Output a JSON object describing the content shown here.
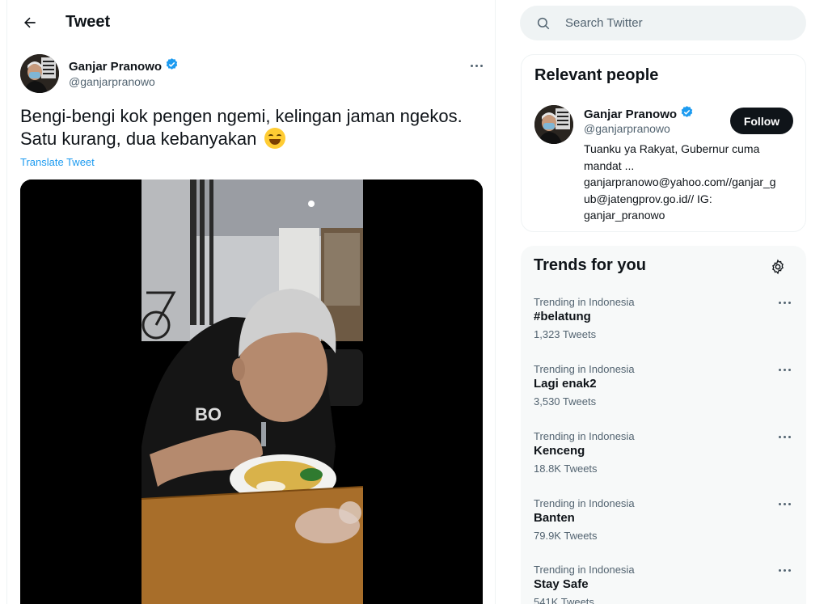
{
  "header": {
    "title": "Tweet"
  },
  "tweet": {
    "author_name": "Ganjar Pranowo",
    "author_handle": "@ganjarpranowo",
    "text_line1": "Bengi-bengi kok pengen ngemi, kelingan jaman ngekos.",
    "text_line2": "Satu kurang, dua kebanyakan",
    "translate_label": "Translate Tweet"
  },
  "search": {
    "placeholder": "Search Twitter"
  },
  "relevant_people": {
    "title": "Relevant people",
    "name": "Ganjar Pranowo",
    "handle": "@ganjarpranowo",
    "follow_label": "Follow",
    "bio_lines": [
      "Tuanku ya Rakyat, Gubernur cuma",
      "mandat ...",
      "ganjarpranowo@yahoo.com//ganjar_g",
      "ub@jatengprov.go.id// IG:",
      "ganjar_pranowo"
    ]
  },
  "trends": {
    "title": "Trends for you",
    "items": [
      {
        "context": "Trending in Indonesia",
        "name": "#belatung",
        "count": "1,323 Tweets"
      },
      {
        "context": "Trending in Indonesia",
        "name": "Lagi enak2",
        "count": "3,530 Tweets"
      },
      {
        "context": "Trending in Indonesia",
        "name": "Kenceng",
        "count": "18.8K Tweets"
      },
      {
        "context": "Trending in Indonesia",
        "name": "Banten",
        "count": "79.9K Tweets"
      },
      {
        "context": "Trending in Indonesia",
        "name": "Stay Safe",
        "count": "541K Tweets"
      }
    ]
  },
  "colors": {
    "accent": "#1d9bf0",
    "text": "#0f1419",
    "muted": "#536471",
    "panel": "#f7f9f9"
  }
}
